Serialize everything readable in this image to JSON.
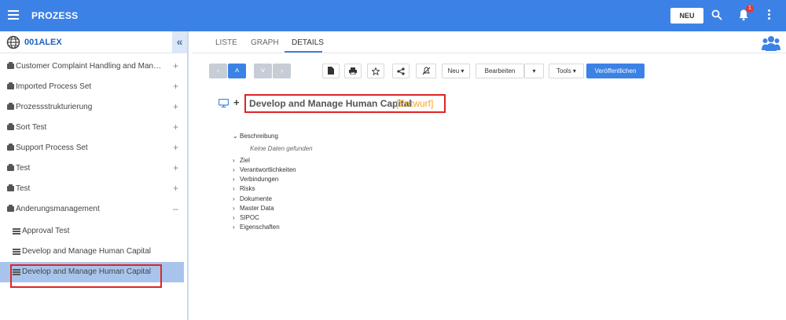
{
  "topbar": {
    "title": "PROZESS",
    "new_button": "NEU",
    "notification_count": "1",
    "accent_color": "#3c82e6"
  },
  "sidebar": {
    "workspace": "001ALEX",
    "collapse_label": "«",
    "items": [
      {
        "label": "Customer Complaint Handling and Managem...",
        "toggle": "+"
      },
      {
        "label": "Imported Process Set",
        "toggle": "+"
      },
      {
        "label": "Prozessstrukturierung",
        "toggle": "+"
      },
      {
        "label": "Sort Test",
        "toggle": "+"
      },
      {
        "label": "Support Process Set",
        "toggle": "+"
      },
      {
        "label": "Test",
        "toggle": "+"
      },
      {
        "label": "Test",
        "toggle": "+"
      },
      {
        "label": "Änderungsmanagement",
        "toggle": "–"
      }
    ],
    "children": [
      {
        "label": "Approval Test"
      },
      {
        "label": "Develop and Manage Human Capital"
      },
      {
        "label": "Develop and Manage Human Capital"
      }
    ]
  },
  "tabs": [
    "LISTE",
    "GRAPH",
    "DETAILS"
  ],
  "toolbar": {
    "nav": [
      "‹",
      "˄",
      "˅",
      "›"
    ],
    "neu": "Neu ▾",
    "bearbeiten": "Bearbeiten",
    "bearbeiten_caret": "▾",
    "tools": "Tools ▾",
    "publish": "Veröffentlichen"
  },
  "process": {
    "expand": "+",
    "title": "Develop and Manage Human Capital",
    "status": "[Entwurf]"
  },
  "details": {
    "sections": [
      {
        "label": "Beschreibung",
        "chevron": "⌄"
      },
      {
        "label": "Ziel",
        "chevron": "›"
      },
      {
        "label": "Verantwortlichkeiten",
        "chevron": "›"
      },
      {
        "label": "Verbindungen",
        "chevron": "›"
      },
      {
        "label": "Risks",
        "chevron": "›"
      },
      {
        "label": "Dokumente",
        "chevron": "›"
      },
      {
        "label": "Master Data",
        "chevron": "›"
      },
      {
        "label": "SIPOC",
        "chevron": "›"
      },
      {
        "label": "Eigenschaften",
        "chevron": "›"
      }
    ],
    "no_data": "Keine Daten gefunden"
  }
}
